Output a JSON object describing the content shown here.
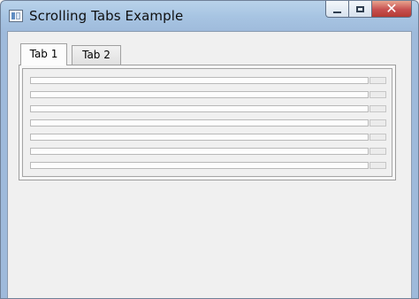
{
  "window": {
    "title": "Scrolling Tabs Example",
    "minimize_label": "",
    "maximize_label": "",
    "close_symbol": "✕"
  },
  "tabs": [
    {
      "label": "Tab 1",
      "selected": true
    },
    {
      "label": "Tab 2",
      "selected": false
    }
  ],
  "rows": [
    {
      "value": ""
    },
    {
      "value": ""
    },
    {
      "value": ""
    },
    {
      "value": ""
    },
    {
      "value": ""
    },
    {
      "value": ""
    },
    {
      "value": ""
    }
  ],
  "colors": {
    "titlebar": "#a7c4e2",
    "close_button": "#c75050",
    "client_background": "#f0f0f0"
  }
}
